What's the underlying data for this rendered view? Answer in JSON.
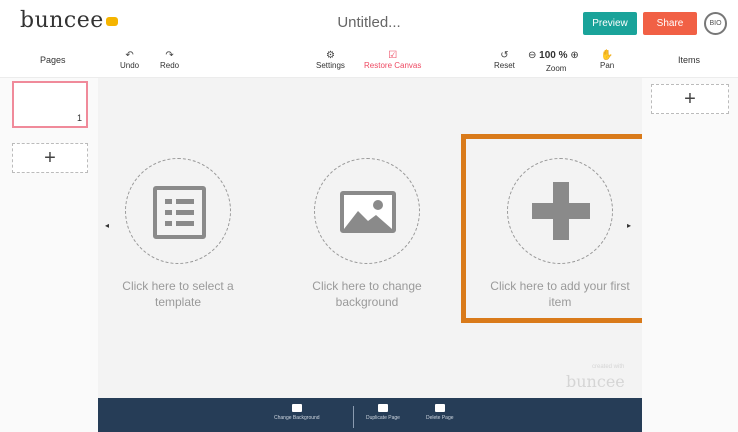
{
  "header": {
    "logo_text": "buncee",
    "doc_title": "Untitled...",
    "preview_label": "Preview",
    "share_label": "Share",
    "avatar_initials": "BIO"
  },
  "panels": {
    "pages_label": "Pages",
    "items_label": "Items",
    "page_number": "1",
    "add_symbol": "+"
  },
  "toolbar": {
    "undo": {
      "label": "Undo",
      "icon": "↶"
    },
    "redo": {
      "label": "Redo",
      "icon": "↷"
    },
    "settings": {
      "label": "Settings",
      "icon": "⚙"
    },
    "restore": {
      "label": "Restore Canvas",
      "icon": "☑"
    },
    "reset": {
      "label": "Reset",
      "icon": "↺"
    },
    "zoom_minus": "⊖",
    "zoom_value": "100 %",
    "zoom_plus": "⊕",
    "zoom_label": "Zoom",
    "pan": {
      "label": "Pan",
      "icon": "✋"
    }
  },
  "canvas": {
    "nav_left": "◂",
    "nav_right": "▸",
    "options": [
      {
        "label": "Click here to select a template"
      },
      {
        "label": "Click here to change background"
      },
      {
        "label": "Click here to add your first item"
      }
    ],
    "watermark": "buncee",
    "watermark_small": "created with"
  },
  "bottom_bar": {
    "items": [
      {
        "label": "Change Background"
      },
      {
        "label": "Duplicate Page"
      },
      {
        "label": "Delete Page"
      }
    ]
  },
  "colors": {
    "preview": "#1aa39a",
    "share": "#f16045",
    "highlight": "#d97a1a",
    "restore": "#ee4a63",
    "bottom_bar": "#263d57"
  }
}
